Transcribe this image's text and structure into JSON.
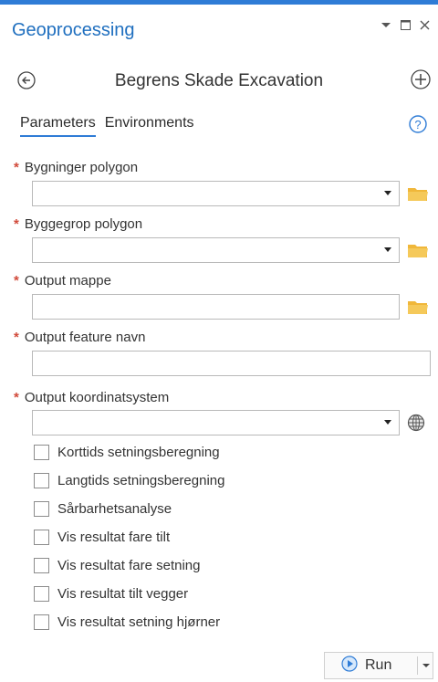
{
  "pane": {
    "title": "Geoprocessing"
  },
  "tool": {
    "title": "Begrens Skade Excavation"
  },
  "tabs": [
    {
      "label": "Parameters"
    },
    {
      "label": "Environments"
    }
  ],
  "params": [
    {
      "label": "Bygninger polygon",
      "value": ""
    },
    {
      "label": "Byggegrop polygon",
      "value": ""
    },
    {
      "label": "Output mappe",
      "value": ""
    },
    {
      "label": "Output feature navn",
      "value": ""
    },
    {
      "label": "Output koordinatsystem",
      "value": ""
    }
  ],
  "required_marker": "*",
  "checkboxes": [
    {
      "label": "Korttids setningsberegning",
      "checked": false
    },
    {
      "label": "Langtids setningsberegning",
      "checked": false
    },
    {
      "label": "Sårbarhetsanalyse",
      "checked": false
    },
    {
      "label": "Vis resultat fare tilt",
      "checked": false
    },
    {
      "label": "Vis resultat fare setning",
      "checked": false
    },
    {
      "label": "Vis resultat tilt vegger",
      "checked": false
    },
    {
      "label": "Vis resultat setning hjørner",
      "checked": false
    }
  ],
  "run": {
    "label": "Run"
  },
  "colors": {
    "accent": "#2f7cd6",
    "title": "#1f6fbf",
    "required": "#d14a3a",
    "folder": "#f0b73a"
  },
  "icons": [
    "back-arrow-icon",
    "add-icon",
    "help-icon",
    "folder-icon",
    "globe-icon",
    "play-icon",
    "pin-icon",
    "maximize-icon",
    "close-icon"
  ]
}
